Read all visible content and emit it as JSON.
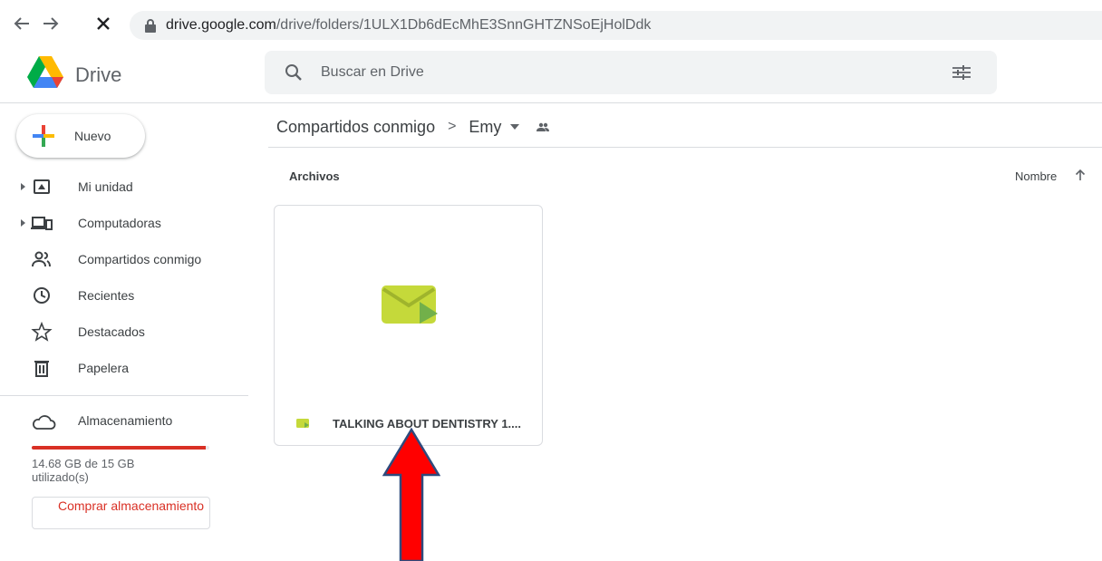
{
  "browser": {
    "url_host": "drive.google.com",
    "url_path": "/drive/folders/1ULX1Db6dEcMhE3SnnGHTZNSoEjHolDdk"
  },
  "header": {
    "app_title": "Drive",
    "search_placeholder": "Buscar en Drive"
  },
  "sidebar": {
    "new_label": "Nuevo",
    "items": [
      {
        "label": "Mi unidad",
        "icon": "my-drive-icon"
      },
      {
        "label": "Computadoras",
        "icon": "computers-icon"
      },
      {
        "label": "Compartidos conmigo",
        "icon": "shared-icon"
      },
      {
        "label": "Recientes",
        "icon": "clock-icon"
      },
      {
        "label": "Destacados",
        "icon": "star-icon"
      },
      {
        "label": "Papelera",
        "icon": "trash-icon"
      }
    ],
    "storage": {
      "label": "Almacenamiento",
      "used_text": "14.68 GB de 15 GB utilizado(s)",
      "used_fraction": 0.979,
      "buy_label": "Comprar almacenamiento",
      "bar_color": "#d93025"
    }
  },
  "main": {
    "breadcrumb": {
      "root": "Compartidos conmigo",
      "separator": ">",
      "current": "Emy"
    },
    "section_title": "Archivos",
    "sort_label": "Nombre",
    "files": [
      {
        "name": "TALKING ABOUT DENTISTRY 1....",
        "icon": "video-message-icon",
        "color": "#c5d93a"
      }
    ]
  }
}
